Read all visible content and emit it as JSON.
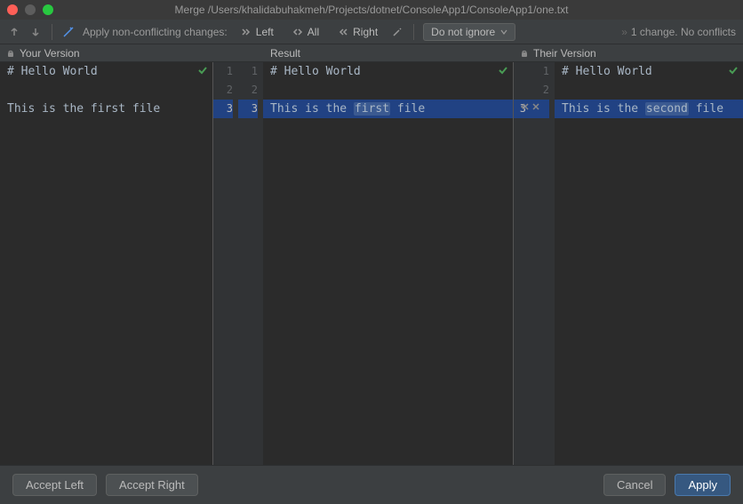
{
  "titlebar": {
    "title": "Merge /Users/khalidabuhakmeh/Projects/dotnet/ConsoleApp1/ConsoleApp1/one.txt"
  },
  "toolbar": {
    "apply_label": "Apply non-conflicting changes:",
    "left_btn": "Left",
    "all_btn": "All",
    "right_btn": "Right",
    "ignore_dropdown": "Do not ignore",
    "status": "1 change. No conflicts"
  },
  "panes": {
    "left_header": "Your Version",
    "mid_header": "Result",
    "right_header": "Their Version",
    "left_lines": [
      "# Hello World",
      "",
      "This is the first file"
    ],
    "mid_lines": [
      "# Hello World",
      "",
      "This is the first file"
    ],
    "right_lines": [
      "# Hello World",
      "",
      "This is the second file"
    ],
    "mid_gutter_left": [
      "1",
      "2",
      "3"
    ],
    "mid_gutter_right": [
      "1",
      "2",
      "3"
    ],
    "right_gutter": [
      "1",
      "2",
      "3"
    ],
    "diff_word_mid": "first",
    "diff_word_right": "second"
  },
  "buttons": {
    "accept_left": "Accept Left",
    "accept_right": "Accept Right",
    "cancel": "Cancel",
    "apply": "Apply"
  }
}
